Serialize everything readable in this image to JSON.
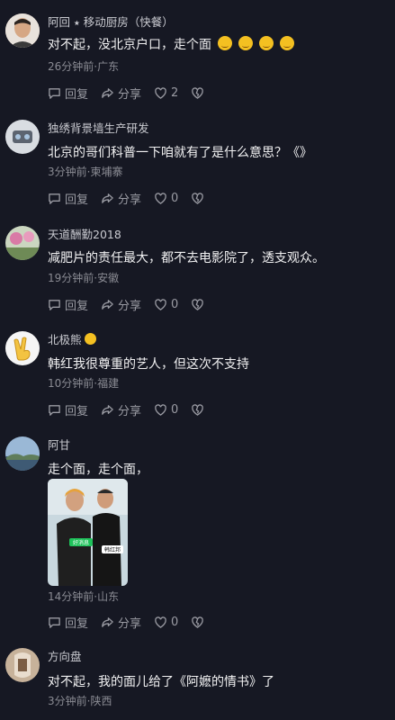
{
  "comments": [
    {
      "user": "阿回 ⭑ 移动厨房（快餐）",
      "text": "对不起，没北京户口，走个面",
      "meta": "26分钟前·广东",
      "reply": "回复",
      "share": "分享",
      "likes": "2",
      "emoji_count": 4
    },
    {
      "user": "独绣背景墙生产研发",
      "text": "北京的哥们科普一下咱就有了是什么意思？《》",
      "meta": "3分钟前·柬埔寨",
      "reply": "回复",
      "share": "分享",
      "likes": "0"
    },
    {
      "user": "天道酬勤2018",
      "text": "减肥片的责任最大，都不去电影院了，透支观众。",
      "meta": "19分钟前·安徽",
      "reply": "回复",
      "share": "分享",
      "likes": "0"
    },
    {
      "user": "北极熊",
      "text": "韩红我很尊重的艺人，但这次不支持",
      "meta": "10分钟前·福建",
      "reply": "回复",
      "share": "分享",
      "likes": "0"
    },
    {
      "user": "阿甘",
      "text": "走个面，走个面，",
      "meta": "14分钟前·山东",
      "reply": "回复",
      "share": "分享",
      "likes": "0",
      "photo_badge_left": "好消息",
      "photo_badge_right": "韩红邦"
    },
    {
      "user": "方向盘",
      "text": "对不起，我的面儿给了《阿嬷的情书》了",
      "meta": "3分钟前·陕西"
    }
  ],
  "colors": {
    "background": "#161823",
    "text": "#f1f1f2",
    "meta": "#8a8b93",
    "emoji": "#f4c021"
  }
}
